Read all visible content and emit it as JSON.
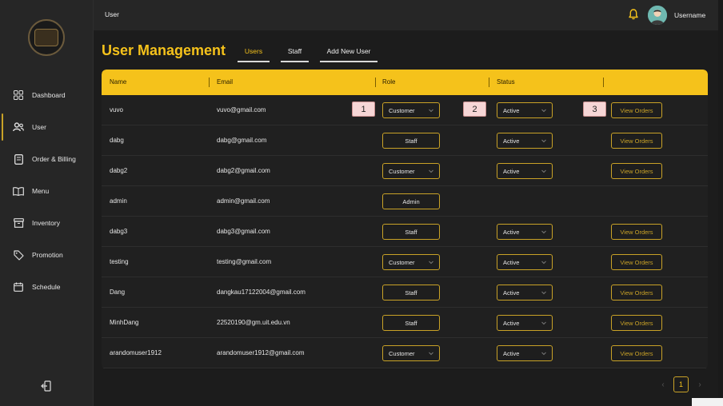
{
  "topbar": {
    "breadcrumb": "User",
    "username": "Username"
  },
  "sidebar": {
    "items": [
      {
        "label": "Dashboard",
        "icon": "grid-icon"
      },
      {
        "label": "User",
        "icon": "users-icon",
        "active": true
      },
      {
        "label": "Order & Billing",
        "icon": "receipt-icon"
      },
      {
        "label": "Menu",
        "icon": "book-icon"
      },
      {
        "label": "Inventory",
        "icon": "box-icon"
      },
      {
        "label": "Promotion",
        "icon": "tag-icon"
      },
      {
        "label": "Schedule",
        "icon": "calendar-icon"
      }
    ]
  },
  "page": {
    "title": "User Management"
  },
  "tabs": [
    {
      "label": "Users",
      "active": true
    },
    {
      "label": "Staff"
    },
    {
      "label": "Add New User"
    }
  ],
  "table": {
    "columns": [
      "Name",
      "Email",
      "Role",
      "Status",
      ""
    ],
    "rows": [
      {
        "name": "vuvo",
        "email": "vuvo@gmail.com",
        "role": "Customer",
        "role_select": true,
        "status": "Active",
        "orders": "View Orders"
      },
      {
        "name": "dabg",
        "email": "dabg@gmail.com",
        "role": "Staff",
        "role_select": false,
        "status": "Active",
        "orders": "View Orders"
      },
      {
        "name": "dabg2",
        "email": "dabg2@gmail.com",
        "role": "Customer",
        "role_select": true,
        "status": "Active",
        "orders": "View Orders"
      },
      {
        "name": "admin",
        "email": "admin@gmail.com",
        "role": "Admin",
        "role_select": false,
        "status": null,
        "orders": null
      },
      {
        "name": "dabg3",
        "email": "dabg3@gmail.com",
        "role": "Staff",
        "role_select": false,
        "status": "Active",
        "orders": "View Orders"
      },
      {
        "name": "testing",
        "email": "testing@gmail.com",
        "role": "Customer",
        "role_select": true,
        "status": "Active",
        "orders": "View Orders"
      },
      {
        "name": "Dang",
        "email": "dangkau17122004@gmail.com",
        "role": "Staff",
        "role_select": false,
        "status": "Active",
        "orders": "View Orders"
      },
      {
        "name": "MinhDang",
        "email": "22520190@gm.uit.edu.vn",
        "role": "Staff",
        "role_select": false,
        "status": "Active",
        "orders": "View Orders"
      },
      {
        "name": "arandomuser1912",
        "email": "arandomuser1912@gmail.com",
        "role": "Customer",
        "role_select": true,
        "status": "Active",
        "orders": "View Orders"
      }
    ]
  },
  "markers": [
    "1",
    "2",
    "3"
  ],
  "pagination": {
    "current": "1",
    "prev": "‹",
    "next": "›"
  },
  "colors": {
    "accent": "#f5c21b",
    "border": "#c9a227",
    "background": "#1c1c1c"
  }
}
